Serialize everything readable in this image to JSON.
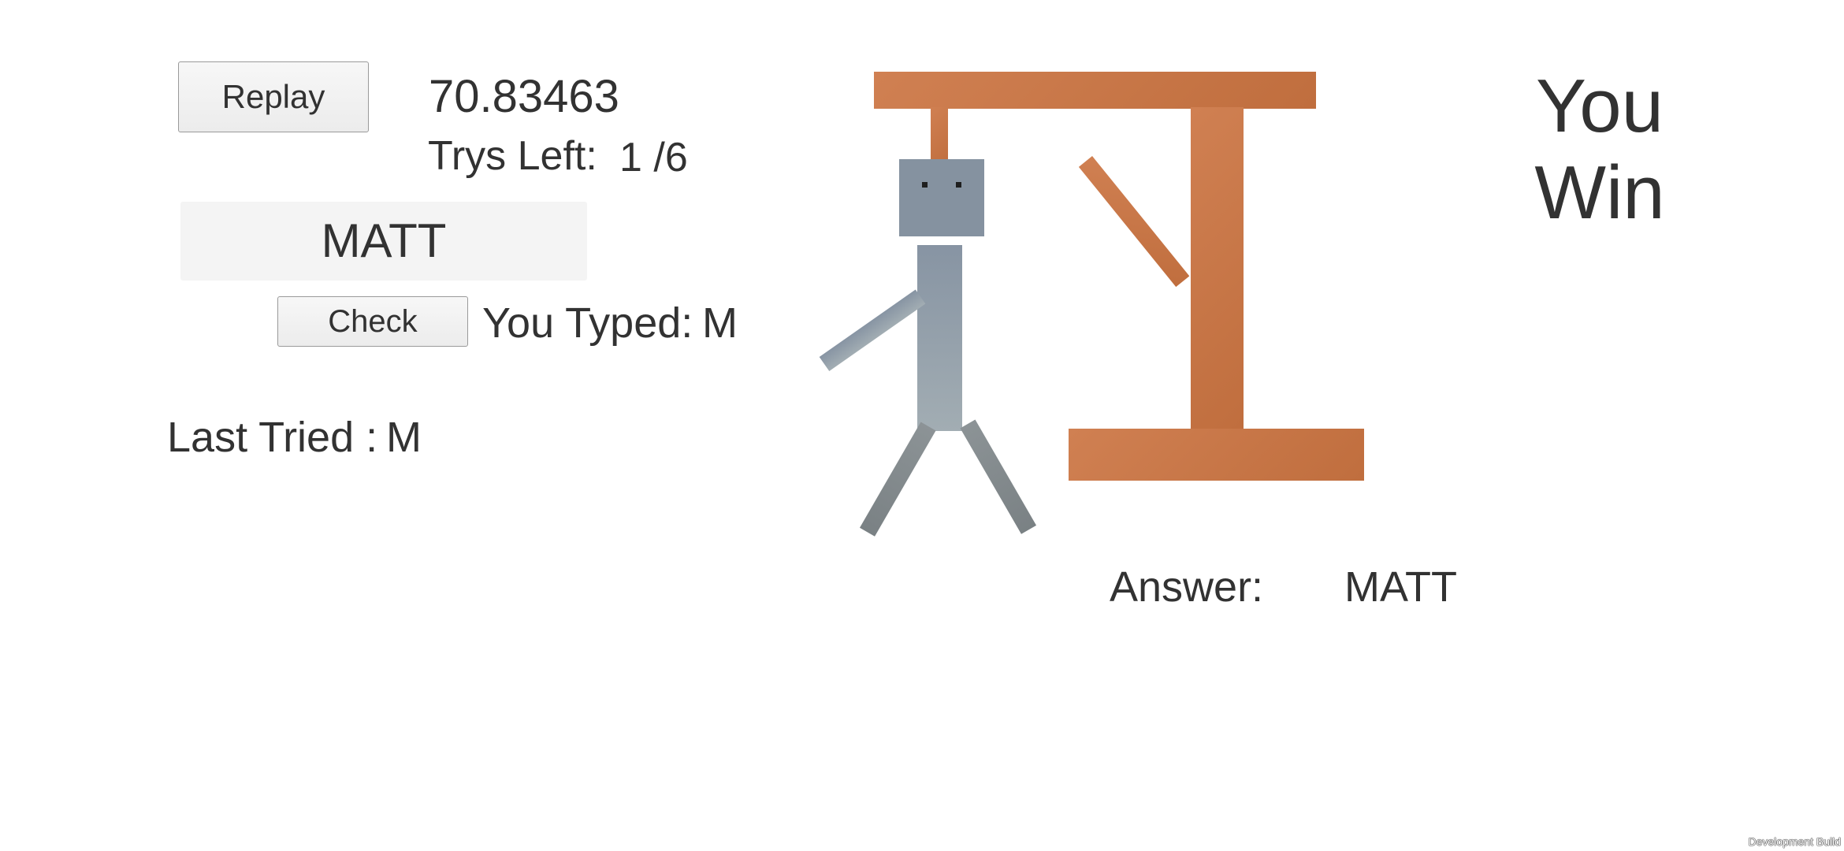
{
  "timer": "70.83463",
  "replay_label": "Replay",
  "tries": {
    "label": "Trys Left:",
    "value": "1 /6"
  },
  "word_display": "MATT",
  "check_label": "Check",
  "typed": {
    "label": "You Typed:",
    "value": "M"
  },
  "last_tried": {
    "label": "Last Tried :",
    "value": "M"
  },
  "result_text": "You Win",
  "answer": {
    "label": "Answer:",
    "value": "MATT"
  },
  "watermark": "Development Build",
  "colors": {
    "gallows": "#c8764a",
    "figure": "#8794a3",
    "text": "#323232"
  }
}
